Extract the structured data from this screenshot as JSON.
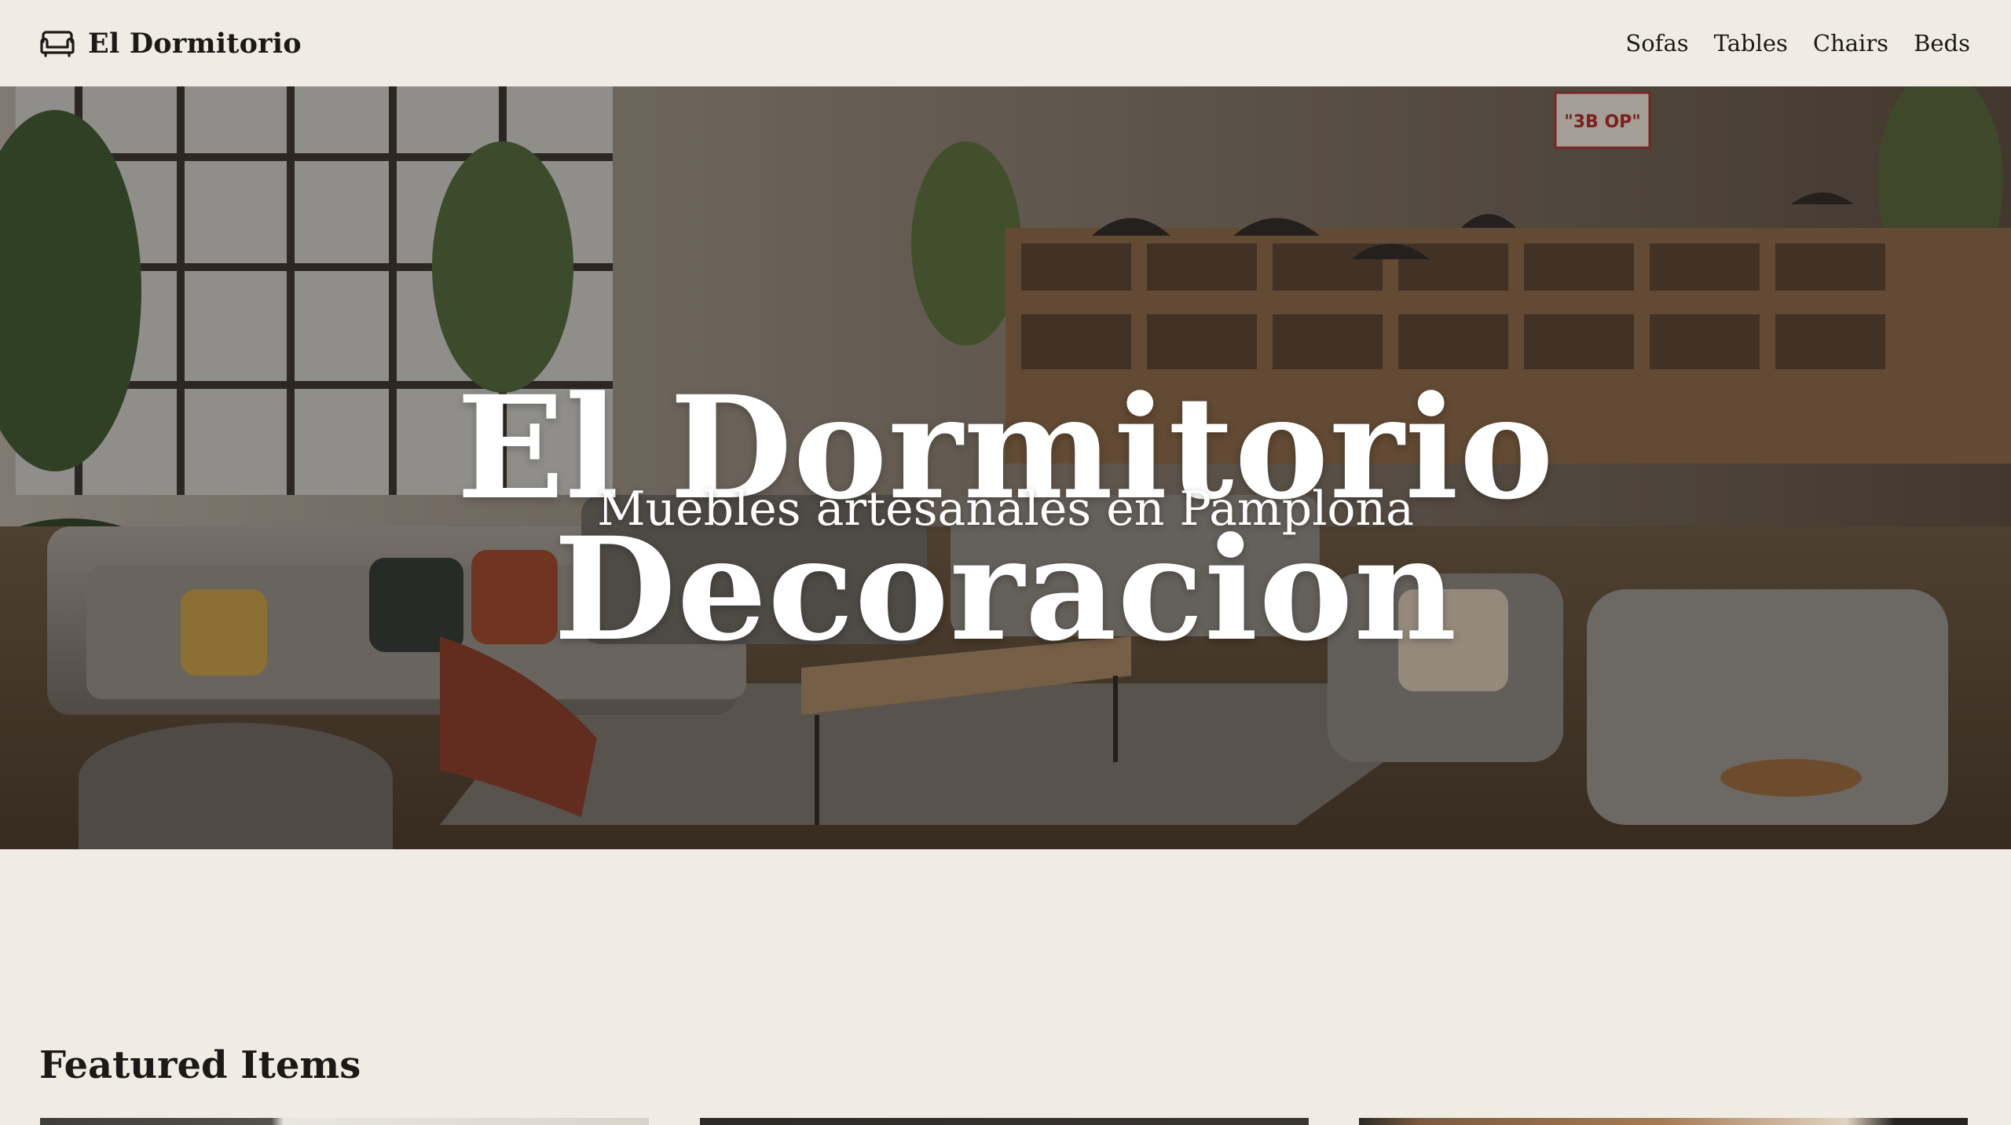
{
  "nav": {
    "brand_icon": "sofa-icon",
    "brand_name": "El Dormitorio",
    "links": [
      {
        "label": "Sofas"
      },
      {
        "label": "Tables"
      },
      {
        "label": "Chairs"
      },
      {
        "label": "Beds"
      }
    ]
  },
  "hero": {
    "title": "El Dormitorio Decoracion",
    "subtitle": "Muebles artesanales en Pamplona",
    "sign_text": "\"3B OP\""
  },
  "featured": {
    "title": "Featured Items"
  },
  "colors": {
    "background": "#f1ece3",
    "text": "#1c1a17",
    "hero_text": "#ffffff"
  }
}
